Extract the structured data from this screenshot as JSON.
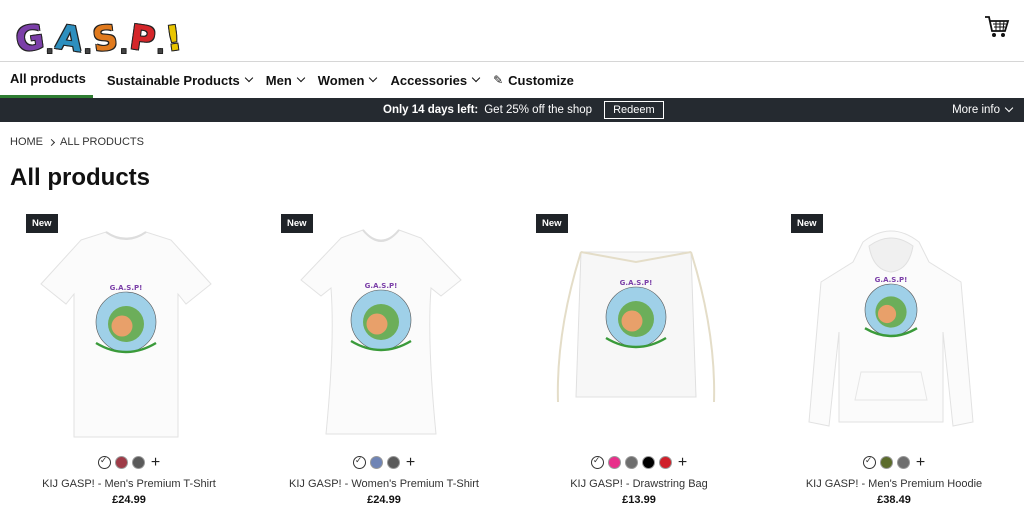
{
  "header": {
    "logo_letters": [
      "G",
      ".",
      "A",
      ".",
      "S",
      ".",
      "P",
      ".",
      "!"
    ],
    "logo_colors": [
      "#7b3fa8",
      "#444444",
      "#2d8fbf",
      "#444444",
      "#e07a1e",
      "#444444",
      "#d4262a",
      "#444444",
      "#e9c500"
    ],
    "cart_icon": "shopping-cart-icon"
  },
  "nav": {
    "items": [
      {
        "label": "All products",
        "dropdown": false
      },
      {
        "label": "Sustainable Products",
        "dropdown": true
      },
      {
        "label": "Men",
        "dropdown": true
      },
      {
        "label": "Women",
        "dropdown": true
      },
      {
        "label": "Accessories",
        "dropdown": true
      },
      {
        "label": "Customize",
        "dropdown": false,
        "icon": "pencil-icon"
      }
    ],
    "active_color": "#2f7d32"
  },
  "promo": {
    "highlight": "Only 14 days left:",
    "text": "Get 25% off the shop",
    "button": "Redeem",
    "more_info": "More info",
    "background": "#252a30"
  },
  "breadcrumb": {
    "home": "HOME",
    "current": "ALL PRODUCTS"
  },
  "page_title": "All products",
  "products": [
    {
      "badge": "New",
      "name": "KIJ GASP! - Men's Premium T-Shirt",
      "price": "£24.99",
      "type": "tshirt",
      "colors": [
        "#ffffff",
        "#9e3b47",
        "#5a5a5a"
      ]
    },
    {
      "badge": "New",
      "name": "KIJ GASP! - Women's Premium T-Shirt",
      "price": "£24.99",
      "type": "womens-tshirt",
      "colors": [
        "#ffffff",
        "#6f84b5",
        "#5a5a5a"
      ]
    },
    {
      "badge": "New",
      "name": "KIJ GASP! - Drawstring Bag",
      "price": "£13.99",
      "type": "bag",
      "colors": [
        "#ffffff",
        "#e8308a",
        "#6e6e6e",
        "#000000",
        "#d01f2a"
      ]
    },
    {
      "badge": "New",
      "name": "KIJ GASP! - Men's Premium Hoodie",
      "price": "£38.49",
      "type": "hoodie",
      "colors": [
        "#ffffff",
        "#5b6b2c",
        "#6e6e6e"
      ]
    }
  ]
}
